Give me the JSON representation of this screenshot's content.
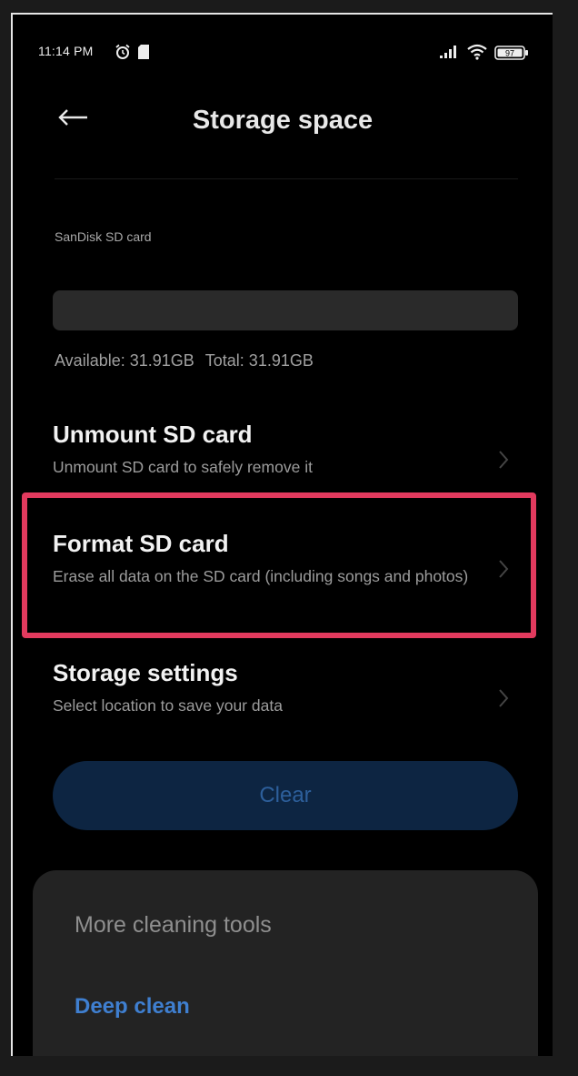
{
  "status_bar": {
    "time": "11:14 PM",
    "battery": "97"
  },
  "header": {
    "title": "Storage space"
  },
  "sd_card": {
    "name": "SanDisk SD card",
    "available": "Available: 31.91GB",
    "total": "Total: 31.91GB",
    "used_fraction": 0.0
  },
  "menu": {
    "items": [
      {
        "title": "Unmount SD card",
        "subtitle": "Unmount SD card to safely remove it"
      },
      {
        "title": "Format SD card",
        "subtitle": "Erase all data on the SD card (including songs and photos)"
      },
      {
        "title": "Storage settings",
        "subtitle": "Select location to save your data"
      }
    ]
  },
  "actions": {
    "clear_label": "Clear"
  },
  "tools": {
    "title": "More cleaning tools",
    "deep_clean": "Deep clean"
  },
  "colors": {
    "highlight": "#e23a5e",
    "accent": "#3f7fd0",
    "clear_button_bg": "#0d2542"
  }
}
